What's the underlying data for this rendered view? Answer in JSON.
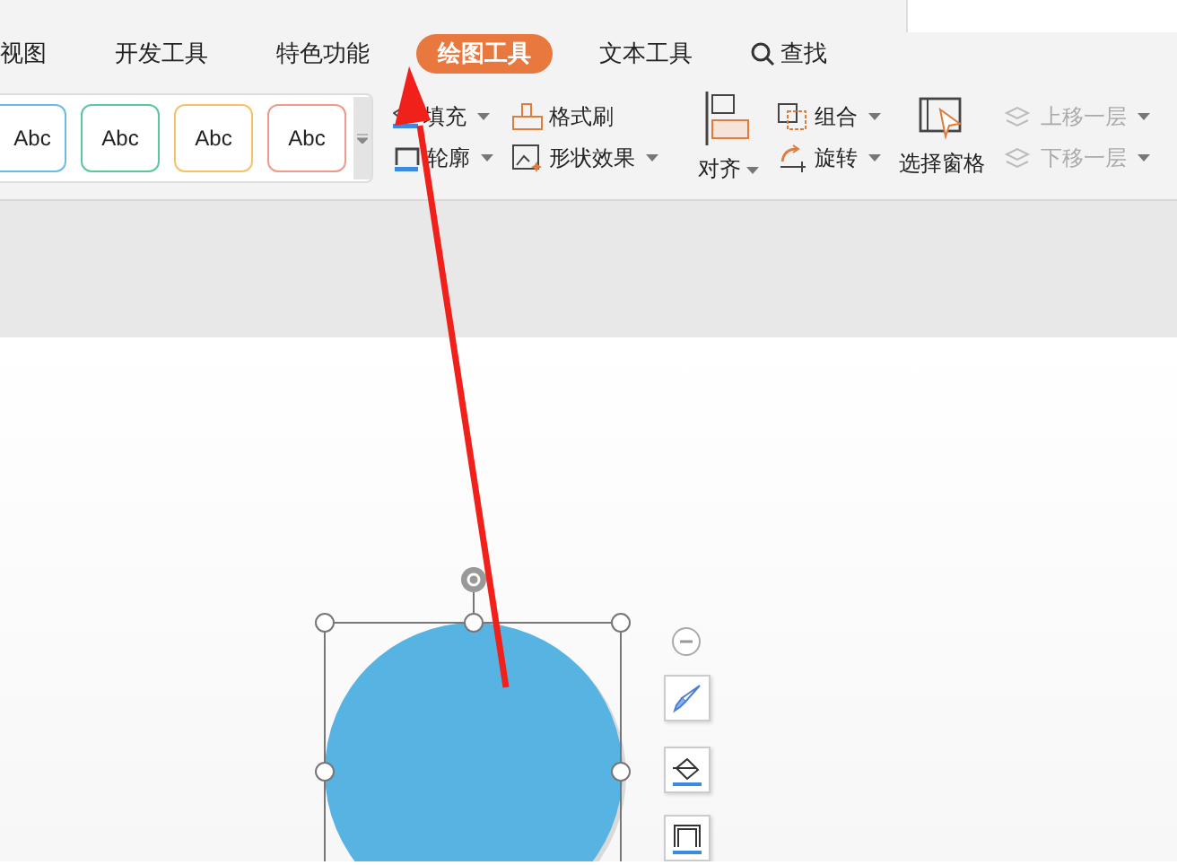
{
  "tabs": [
    {
      "label": "视图",
      "selected": false
    },
    {
      "label": "开发工具",
      "selected": false
    },
    {
      "label": "特色功能",
      "selected": false
    },
    {
      "label": "绘图工具",
      "selected": true
    },
    {
      "label": "文本工具",
      "selected": false
    }
  ],
  "search": {
    "label": "查找"
  },
  "style_gallery": [
    {
      "label": "Abc",
      "color": "#6bbbe6"
    },
    {
      "label": "Abc",
      "color": "#5cc79a"
    },
    {
      "label": "Abc",
      "color": "#f5c26b"
    },
    {
      "label": "Abc",
      "color": "#ef9a8a"
    }
  ],
  "ribbon": [
    {
      "kind": "small",
      "label": "填充",
      "dropdown": true,
      "disabled": false
    },
    {
      "kind": "small",
      "label": "轮廓",
      "dropdown": true,
      "disabled": false
    },
    {
      "kind": "small",
      "label": "格式刷",
      "dropdown": false,
      "disabled": false
    },
    {
      "kind": "small",
      "label": "形状效果",
      "dropdown": true,
      "disabled": false
    },
    {
      "kind": "large",
      "label": "对齐",
      "dropdown": true,
      "disabled": false
    },
    {
      "kind": "small",
      "label": "组合",
      "dropdown": true,
      "disabled": false
    },
    {
      "kind": "small",
      "label": "旋转",
      "dropdown": true,
      "disabled": false
    },
    {
      "kind": "large",
      "label": "选择窗格",
      "dropdown": false,
      "disabled": false
    },
    {
      "kind": "small",
      "label": "上移一层",
      "dropdown": true,
      "disabled": true
    },
    {
      "kind": "small",
      "label": "下移一层",
      "dropdown": true,
      "disabled": true
    }
  ]
}
